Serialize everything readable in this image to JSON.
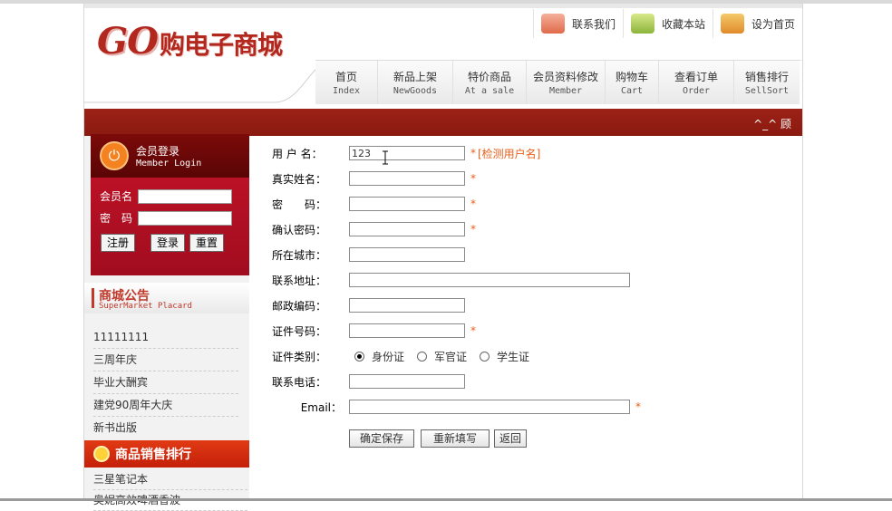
{
  "header": {
    "logo_go": "GO",
    "logo_cn": "购电子商城",
    "top_links": [
      "联系我们",
      "收藏本站",
      "设为首页"
    ]
  },
  "nav": [
    {
      "cn": "首页",
      "en": "Index"
    },
    {
      "cn": "新品上架",
      "en": "NewGoods"
    },
    {
      "cn": "特价商品",
      "en": "At a sale"
    },
    {
      "cn": "会员资料修改",
      "en": "Member"
    },
    {
      "cn": "购物车",
      "en": "Cart"
    },
    {
      "cn": "查看订单",
      "en": "Order"
    },
    {
      "cn": "销售排行",
      "en": "SellSort"
    }
  ],
  "marquee": "^_^ 顾",
  "login": {
    "title_cn": "会员登录",
    "title_en": "Member Login",
    "username_label": "会员名",
    "password_label": "密　码",
    "register": "注册",
    "login": "登录",
    "reset": "重置"
  },
  "notice": {
    "title_cn": "商城公告",
    "title_en": "SuperMarket Placard",
    "items": [
      "11111111",
      "三周年庆",
      "毕业大酬宾",
      "建党90周年大庆",
      "新书出版"
    ]
  },
  "rank": {
    "title": "商品销售排行",
    "items": [
      "三星笔记本",
      "奥妮高效啤酒香波"
    ]
  },
  "form": {
    "required_mark": "*",
    "username": {
      "label": "用 户 名：",
      "value": "123",
      "check": "[检测用户名]"
    },
    "realname": "真实姓名：",
    "password": "密　　码：",
    "confirm": "确认密码：",
    "city": "所在城市：",
    "address": "联系地址：",
    "postcode": "邮政编码：",
    "idnumber": "证件号码：",
    "idtype": {
      "label": "证件类别：",
      "options": [
        "身份证",
        "军官证",
        "学生证"
      ],
      "selected": "身份证"
    },
    "phone": "联系电话：",
    "email": "Email：",
    "buttons": {
      "save": "确定保存",
      "refill": "重新填写",
      "back": "返回"
    }
  }
}
